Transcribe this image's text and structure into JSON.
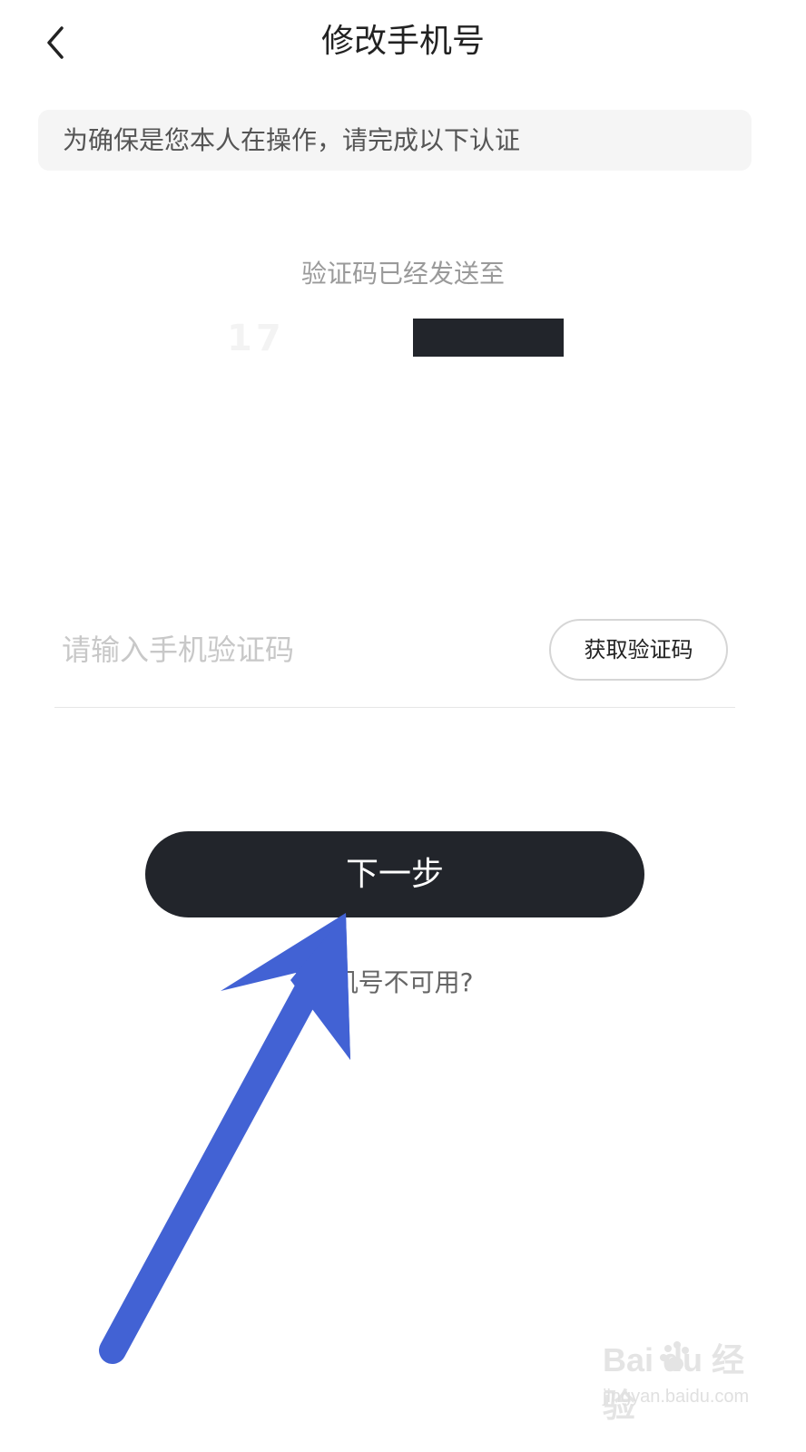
{
  "header": {
    "title": "修改手机号",
    "back_icon": "chevron-left-icon"
  },
  "notice": {
    "text": "为确保是您本人在操作，请完成以下认证"
  },
  "verification": {
    "sent_label": "验证码已经发送至",
    "phone_visible": "17",
    "code_placeholder": "请输入手机验证码",
    "code_value": "",
    "get_code_label": "获取验证码"
  },
  "actions": {
    "next_label": "下一步",
    "unavailable_label": "机号不可用?"
  },
  "annotation": {
    "arrow_color": "#4262d4",
    "arrow_icon": "arrow-up-right-icon"
  },
  "watermark": {
    "logo": "Bai du 经验",
    "url": "jingyan.baidu.com"
  },
  "colors": {
    "primary_button": "#22252b",
    "notice_bg": "#f5f5f5",
    "muted_text": "#9a9a9a"
  }
}
